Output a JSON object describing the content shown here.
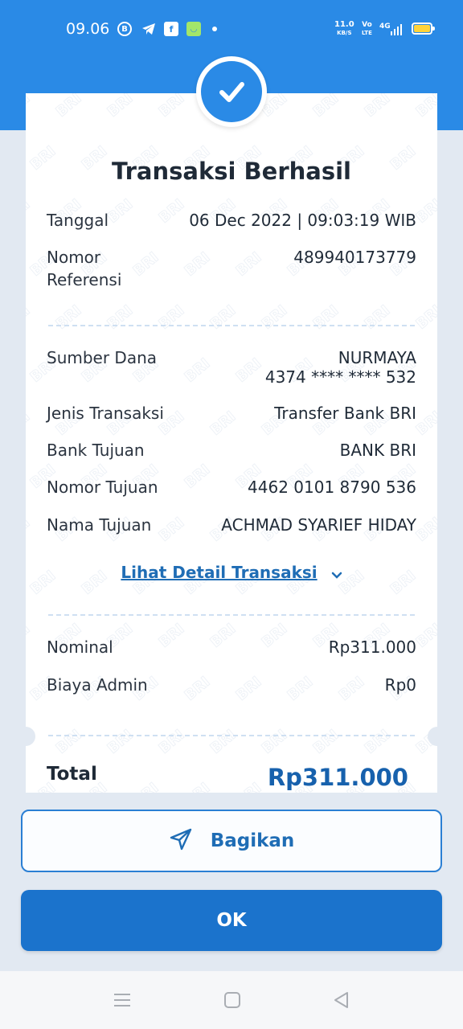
{
  "status_bar": {
    "time": "09.06",
    "net_speed_value": "11.0",
    "net_speed_unit": "KB/S",
    "volte_top": "Vo",
    "volte_bottom": "LTE",
    "network": "4G",
    "battery_color": "#ffd33a"
  },
  "receipt": {
    "title": "Transaksi Berhasil",
    "rows_top": [
      {
        "label": "Tanggal",
        "value": "06 Dec 2022 | 09:03:19 WIB"
      },
      {
        "label": "Nomor Referensi",
        "value": "489940173779"
      }
    ],
    "source": {
      "label": "Sumber Dana",
      "name": "NURMAYA",
      "account": "4374 **** **** 532"
    },
    "rows_mid": [
      {
        "label": "Jenis Transaksi",
        "value": "Transfer Bank BRI"
      },
      {
        "label": "Bank Tujuan",
        "value": "BANK BRI"
      },
      {
        "label": "Nomor Tujuan",
        "value": "4462 0101 8790 536"
      },
      {
        "label": "Nama Tujuan",
        "value": "ACHMAD SYARIEF HIDAY"
      }
    ],
    "detail_link": "Lihat Detail Transaksi",
    "rows_bottom": [
      {
        "label": "Nominal",
        "value": "Rp311.000"
      },
      {
        "label": "Biaya Admin",
        "value": "Rp0"
      }
    ],
    "total_label": "Total",
    "total_value": "Rp311.000",
    "watermark_text": "BRI"
  },
  "buttons": {
    "share_label": "Bagikan",
    "ok_label": "OK"
  },
  "colors": {
    "header_blue": "#2a8ae6",
    "primary_blue": "#1b73cc",
    "total_blue": "#1761ad",
    "background": "#e2e9f2"
  },
  "nav_icons": [
    "menu-icon",
    "home-square-icon",
    "back-triangle-icon"
  ]
}
